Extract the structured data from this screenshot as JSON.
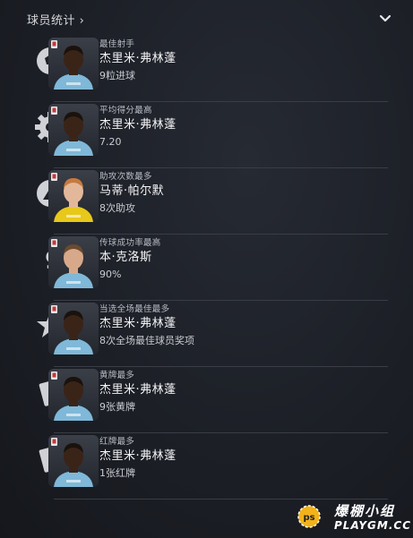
{
  "header": {
    "title": "球员统计 ›"
  },
  "stats": [
    {
      "category": "最佳射手",
      "player": "杰里米·弗林蓬",
      "value": "9粒进球",
      "badge_icon": "ball-icon",
      "kit_color": "#7fb8d8",
      "skin": "#3a2418",
      "hair": "#1a120c"
    },
    {
      "category": "平均得分最高",
      "player": "杰里米·弗林蓬",
      "value": "7.20",
      "badge_icon": "gear-icon",
      "kit_color": "#7fb8d8",
      "skin": "#3a2418",
      "hair": "#1a120c"
    },
    {
      "category": "助攻次数最多",
      "player": "马蒂·帕尔默",
      "value": "8次助攻",
      "badge_icon": "assist-icon",
      "kit_color": "#e8c81a",
      "skin": "#e3b89a",
      "hair": "#c77a3e"
    },
    {
      "category": "传球成功率最高",
      "player": "本·克洛斯",
      "value": "90%",
      "badge_icon": "pass-icon",
      "kit_color": "#7fb8d8",
      "skin": "#d7a98a",
      "hair": "#6b4a2e"
    },
    {
      "category": "当选全场最佳最多",
      "player": "杰里米·弗林蓬",
      "value": "8次全场最佳球员奖项",
      "badge_icon": "star-icon",
      "kit_color": "#7fb8d8",
      "skin": "#3a2418",
      "hair": "#1a120c"
    },
    {
      "category": "黄牌最多",
      "player": "杰里米·弗林蓬",
      "value": "9张黄牌",
      "badge_icon": "yellow-card-icon",
      "kit_color": "#7fb8d8",
      "skin": "#3a2418",
      "hair": "#1a120c"
    },
    {
      "category": "红牌最多",
      "player": "杰里米·弗林蓬",
      "value": "1张红牌",
      "badge_icon": "red-card-icon",
      "kit_color": "#7fb8d8",
      "skin": "#3a2418",
      "hair": "#1a120c"
    }
  ],
  "watermark": {
    "line1": "爆棚小组",
    "line2": "PLAYGM.CC",
    "logo_text": "ps"
  }
}
